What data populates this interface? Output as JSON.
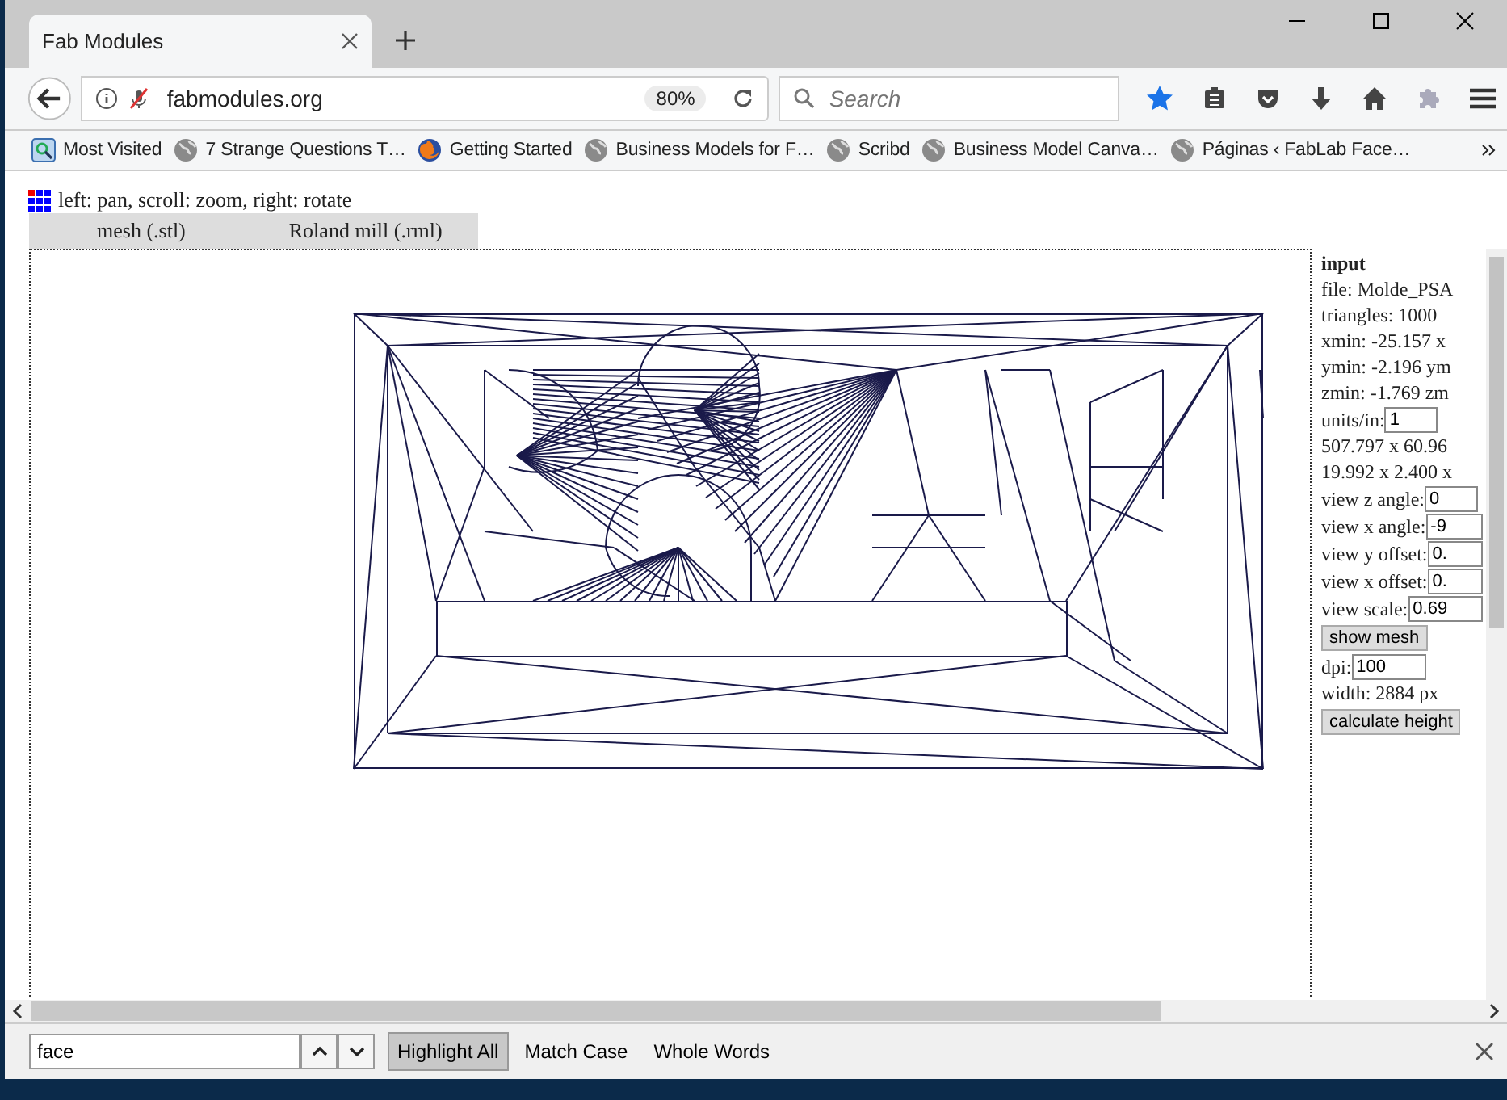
{
  "tabs": [
    {
      "title": "Fab Modules",
      "selected": true
    }
  ],
  "address_bar": {
    "url": "fabmodules.org",
    "zoom": "80%"
  },
  "search": {
    "placeholder": "Search"
  },
  "bookmarks": [
    {
      "label": "Most Visited",
      "kind": "folder"
    },
    {
      "label": "7 Strange Questions T…",
      "kind": "globe"
    },
    {
      "label": "Getting Started",
      "kind": "firefox"
    },
    {
      "label": "Business Models for F…",
      "kind": "globe"
    },
    {
      "label": "Scribd",
      "kind": "globe"
    },
    {
      "label": "Business Model Canva…",
      "kind": "globe"
    },
    {
      "label": "Páginas ‹ FabLab Face…",
      "kind": "globe"
    }
  ],
  "page": {
    "hint": "left: pan, scroll: zoom, right: rotate",
    "tabs": [
      {
        "label": "mesh (.stl)"
      },
      {
        "label": "Roland mill (.rml)"
      }
    ],
    "panel": [
      {
        "kind": "heading",
        "text": "input"
      },
      {
        "kind": "text",
        "text": "file: Molde_PSA"
      },
      {
        "kind": "text",
        "text": "triangles: 1000"
      },
      {
        "kind": "text",
        "text": "xmin: -25.157 x"
      },
      {
        "kind": "text",
        "text": "ymin: -2.196 ym"
      },
      {
        "kind": "text",
        "text": "zmin: -1.769 zm"
      },
      {
        "kind": "field",
        "label": "units/in:",
        "value": "1"
      },
      {
        "kind": "text",
        "text": "507.797 x 60.96"
      },
      {
        "kind": "text",
        "text": "19.992 x 2.400 x"
      },
      {
        "kind": "field",
        "label": "view z angle:",
        "value": "0"
      },
      {
        "kind": "field",
        "label": "view x angle:",
        "value": "-9"
      },
      {
        "kind": "field",
        "label": "view y offset:",
        "value": "0."
      },
      {
        "kind": "field",
        "label": "view x offset:",
        "value": "0."
      },
      {
        "kind": "field",
        "label": "view scale:",
        "value": "0.69"
      },
      {
        "kind": "button",
        "label": "show mesh"
      },
      {
        "kind": "field",
        "label": "dpi:",
        "value": "100"
      },
      {
        "kind": "text",
        "text": "width: 2884 px"
      },
      {
        "kind": "button",
        "label": "calculate height"
      }
    ]
  },
  "find_bar": {
    "value": "face",
    "options": [
      {
        "label": "Highlight All",
        "selected": true
      },
      {
        "label": "Match Case",
        "selected": false
      },
      {
        "label": "Whole Words",
        "selected": false
      }
    ]
  }
}
